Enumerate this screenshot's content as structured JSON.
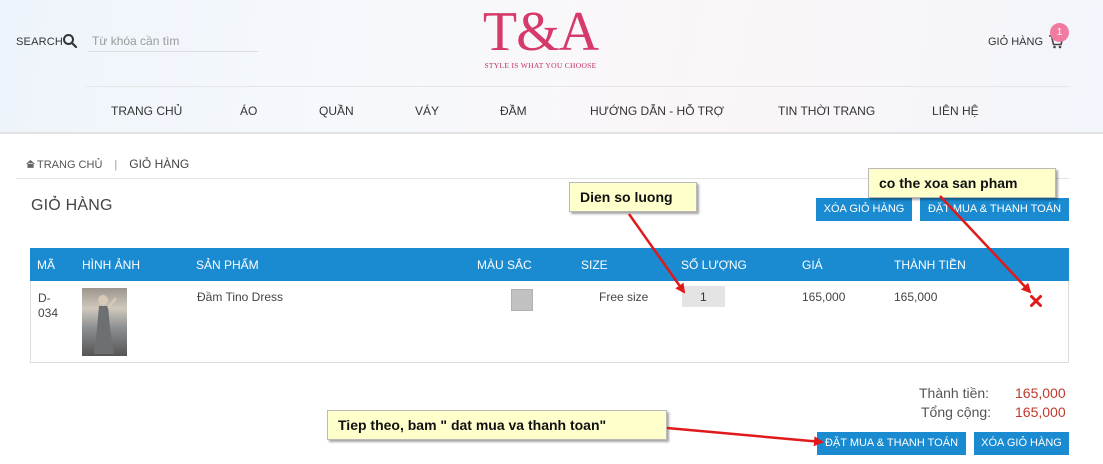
{
  "header": {
    "search_label": "SEARCH",
    "search_placeholder": "Từ khóa cần tìm",
    "logo_text": "T&A",
    "logo_tagline": "STYLE IS WHAT YOU CHOOSE",
    "cart_label": "GIỎ HÀNG",
    "cart_count": "1",
    "icons": [
      "search-icon",
      "cart-icon"
    ]
  },
  "nav": {
    "items": [
      "TRANG CHỦ",
      "ÁO",
      "QUẦN",
      "VÁY",
      "ĐẦM",
      "HƯỚNG DẪN - HỖ TRỢ",
      "TIN THỜI TRANG",
      "LIÊN HỆ"
    ]
  },
  "breadcrumb": {
    "home": "TRANG CHỦ",
    "separator": "|",
    "current": "GIỎ HÀNG"
  },
  "page": {
    "title": "GIỎ HÀNG",
    "clear_cart_label": "XÓA GIỎ HÀNG",
    "checkout_label": "ĐẶT MUA & THANH TOÁN"
  },
  "table": {
    "headers": [
      "MÃ",
      "HÌNH ẢNH",
      "SẢN PHẨM",
      "MÀU SẮC",
      "SIZE",
      "SỐ LƯỢNG",
      "GIÁ",
      "THÀNH TIỀN"
    ],
    "rows": [
      {
        "code_line1": "D-",
        "code_line2": "034",
        "product": "Đầm Tino Dress",
        "color": "#c1c1c1",
        "size": "Free size",
        "quantity": "1",
        "price": "165,000",
        "total": "165,000"
      }
    ]
  },
  "summary": {
    "subtotal_label": "Thành tiền:",
    "subtotal_value": "165,000",
    "total_label": "Tổng cộng:",
    "total_value": "165,000"
  },
  "annotations": {
    "quantity_note": "Dien so luong",
    "delete_note": "co the xoa san pham",
    "checkout_note": "Tiep theo, bam \" dat mua va thanh toan\""
  },
  "colors": {
    "accent": "#1a8bd0",
    "brand": "#d63a6a",
    "price": "#c0392b",
    "callout_bg": "#ffffcc",
    "arrow": "#e0191b",
    "badge": "#f07aa0"
  }
}
